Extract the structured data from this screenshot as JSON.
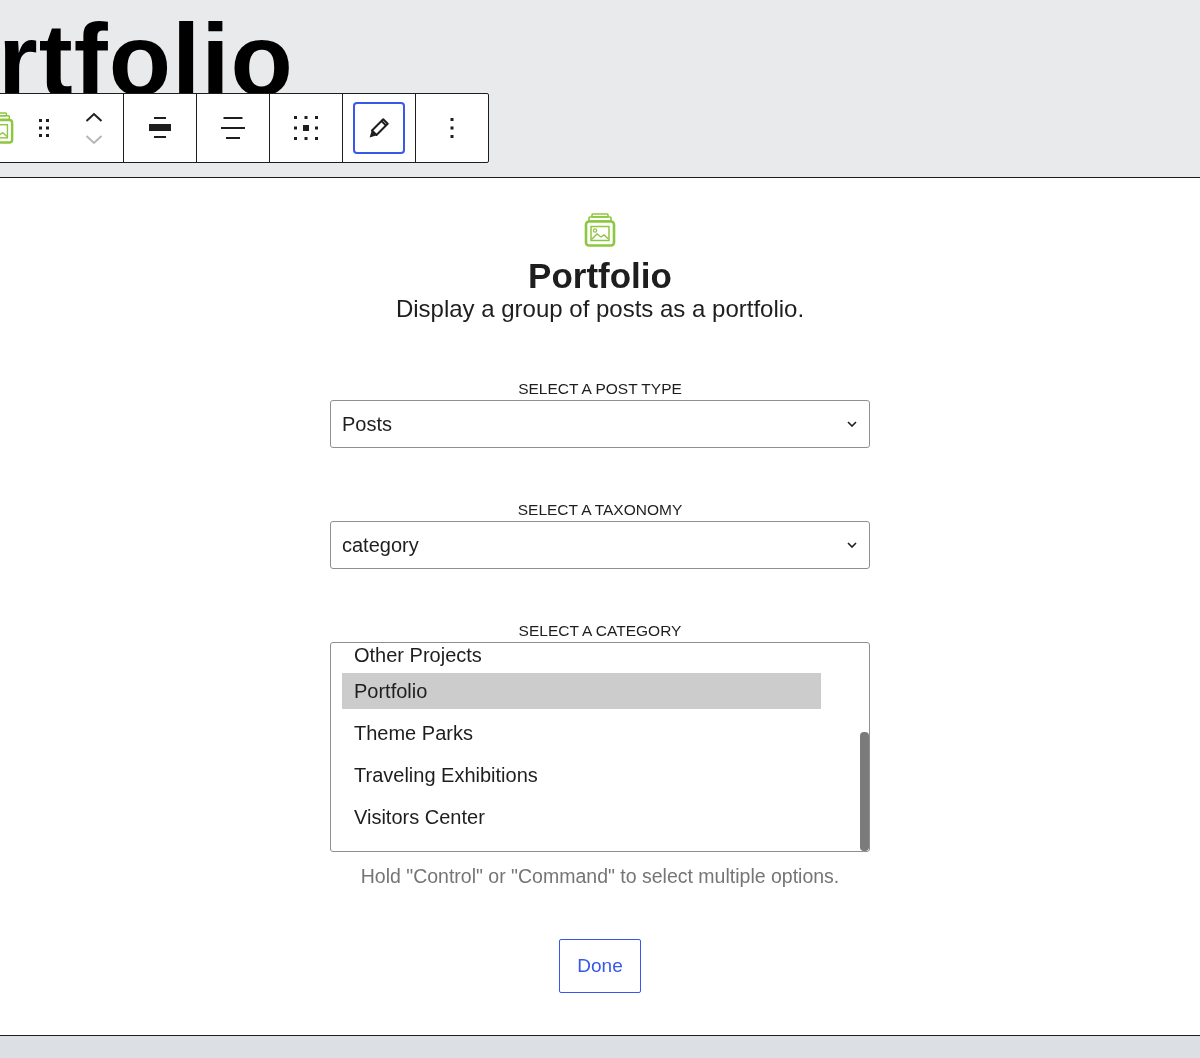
{
  "editor_canvas": {
    "heading": "rtfolio"
  },
  "block_toolbar": {
    "groups": [
      {
        "items": [
          {
            "kind": "block-type",
            "pressed": false,
            "disabled": false
          },
          {
            "kind": "drag",
            "pressed": false,
            "disabled": false
          },
          {
            "kind": "move-up",
            "pressed": false,
            "disabled": false
          },
          {
            "kind": "move-down",
            "pressed": false,
            "disabled": true
          }
        ]
      },
      {
        "items": [
          {
            "kind": "align-wide",
            "pressed": false,
            "disabled": false
          }
        ]
      },
      {
        "items": [
          {
            "kind": "align-center",
            "pressed": false,
            "disabled": false
          }
        ]
      },
      {
        "items": [
          {
            "kind": "justify",
            "pressed": false,
            "disabled": false
          }
        ]
      },
      {
        "items": [
          {
            "kind": "edit",
            "pressed": true,
            "disabled": false
          }
        ]
      },
      {
        "items": [
          {
            "kind": "more",
            "pressed": false,
            "disabled": false
          }
        ]
      }
    ]
  },
  "placeholder": {
    "title": "Portfolio",
    "description": "Display a group of posts as a portfolio.",
    "fields": [
      {
        "kind": "select",
        "label": "SELECT A POST TYPE",
        "value": "Posts"
      },
      {
        "kind": "select",
        "label": "SELECT A TAXONOMY",
        "value": "category"
      },
      {
        "kind": "listbox",
        "label": "SELECT A CATEGORY",
        "options": [
          {
            "label": "Other Projects",
            "selected": false
          },
          {
            "label": "Portfolio",
            "selected": true
          },
          {
            "label": "Theme Parks",
            "selected": false
          },
          {
            "label": "Traveling Exhibitions",
            "selected": false
          },
          {
            "label": "Visitors Center",
            "selected": false
          }
        ]
      }
    ],
    "hint": "Hold \"Control\" or \"Command\" to select multiple options.",
    "button": "Done"
  }
}
